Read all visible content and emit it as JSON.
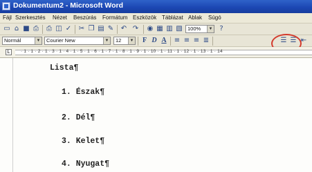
{
  "window": {
    "title": "Dokumentum2 - Microsoft Word"
  },
  "menubar": [
    "Fájl",
    "Szerkesztés",
    "Nézet",
    "Beszúrás",
    "Formátum",
    "Eszközök",
    "Táblázat",
    "Ablak",
    "Súgó"
  ],
  "toolbar": {
    "zoom": "100%",
    "style": "Normál",
    "font": "Courier New",
    "size": "12",
    "bold": "F",
    "italic": "D",
    "underline": "A"
  },
  "ruler": {
    "text": "· 1 · 1 · 2 · 1 · 3 · 1 · 4 · 1 · 5 · 1 · 6 · 1 · 7 · 1 · 8 · 1 · 9 · 1 · 10 · 1 · 11 · 1 · 12 · 1 · 13 · 1 · 14"
  },
  "document": {
    "heading": "Lista¶",
    "items": [
      "1. Észak¶",
      "2. Dél¶",
      "3. Kelet¶",
      "4. Nyugat¶"
    ]
  }
}
